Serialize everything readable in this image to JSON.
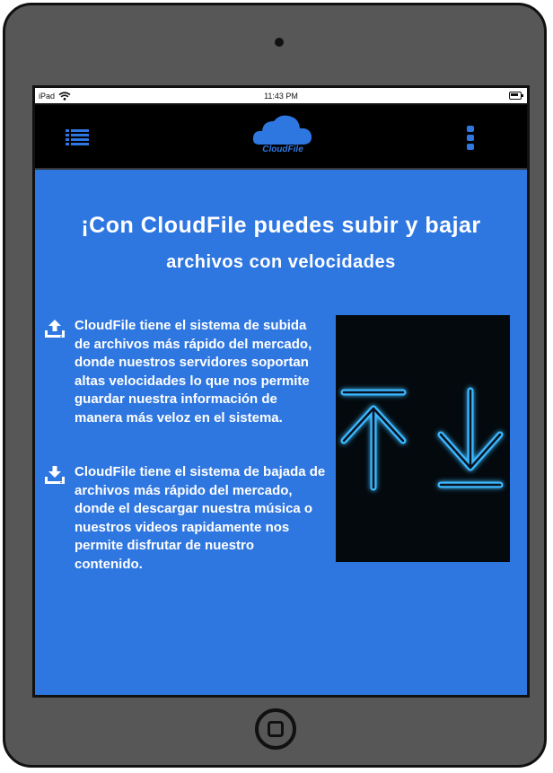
{
  "device": {
    "name": "iPad",
    "time": "11:43 PM"
  },
  "header": {
    "logo_text": "CloudFile",
    "menu_icon": "list-icon",
    "more_icon": "vertical-ellipsis-icon"
  },
  "main": {
    "headline": "¡Con CloudFile puedes subir y bajar",
    "subheadline": "archivos con velocidades",
    "features": [
      {
        "icon": "upload-icon",
        "text": "CloudFile tiene el sistema de subida de archivos más rápido del mercado, donde nuestros servidores soportan altas velocidades lo que nos permite guardar nuestra información de manera más veloz en el sistema."
      },
      {
        "icon": "download-icon",
        "text": "CloudFile tiene el sistema de bajada de archivos más rápido del mercado, donde el descargar nuestra música o nuestros videos rapidamente nos permite disfrutar de nuestro contenido."
      }
    ]
  },
  "colors": {
    "accent": "#2f77e0",
    "header_bg": "#000000",
    "neon": "#3ab8ff"
  }
}
